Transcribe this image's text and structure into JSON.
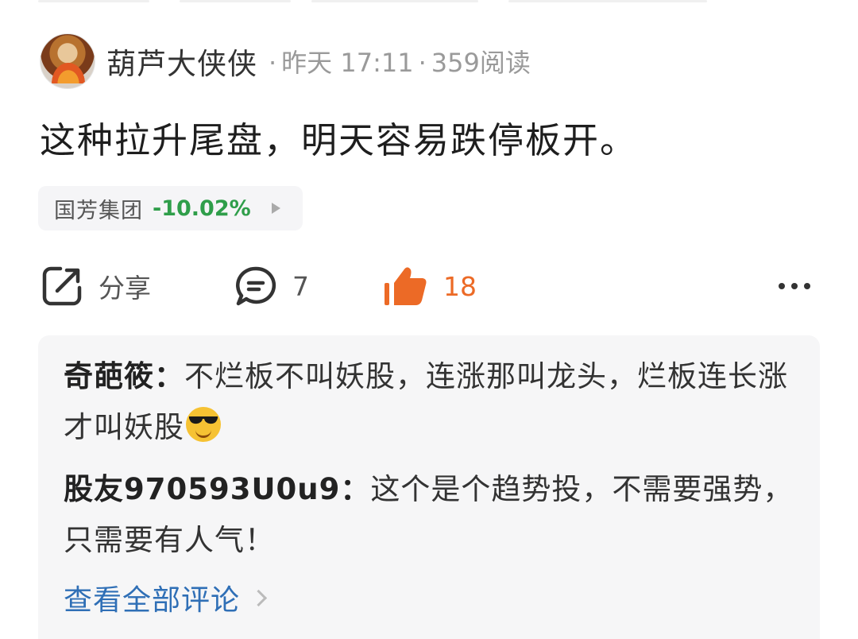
{
  "post": {
    "author": "葫芦大侠侠",
    "time": "昨天 17:11",
    "reads": "359阅读",
    "content": "这种拉升尾盘，明天容易跌停板开。"
  },
  "stock": {
    "name": "国芳集团",
    "change": "-10.02%",
    "change_color": "#2f9e4a"
  },
  "actions": {
    "share_label": "分享",
    "comment_count": "7",
    "like_count": "18",
    "like_color": "#ec6a26",
    "icons": [
      "share-icon",
      "comment-icon",
      "thumbs-up-icon",
      "more-icon"
    ]
  },
  "comments": [
    {
      "user": "奇葩筱：",
      "text": "不烂板不叫妖股，连涨那叫龙头，烂板连长涨才叫妖股",
      "emoji": "sunglasses-emoji"
    },
    {
      "user": "股友970593U0u9：",
      "text": "这个是个趋势投，不需要强势，只需要有人气！"
    }
  ],
  "view_all_label": "查看全部评论"
}
